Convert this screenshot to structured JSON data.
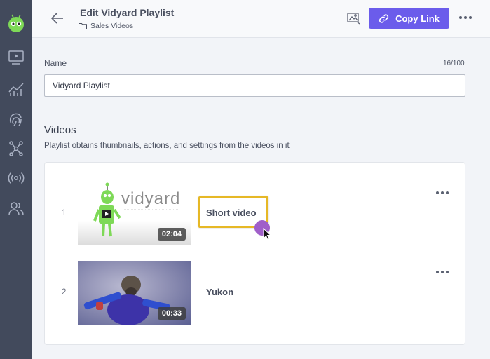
{
  "header": {
    "title": "Edit Vidyard Playlist",
    "breadcrumb": "Sales Videos",
    "copy_link_label": "Copy Link"
  },
  "name_field": {
    "label": "Name",
    "counter": "16/100",
    "value": "Vidyard Playlist"
  },
  "videos": {
    "heading": "Videos",
    "description": "Playlist obtains thumbnails, actions, and settings from the videos in it",
    "items": [
      {
        "index": "1",
        "title": "Short video",
        "duration": "02:04",
        "thumbnail_text": "vidyard"
      },
      {
        "index": "2",
        "title": "Yukon",
        "duration": "00:33"
      }
    ]
  },
  "sidebar": {
    "icons": [
      "logo-robot-icon",
      "video-library-icon",
      "analytics-icon",
      "fingerprint-icon",
      "network-icon",
      "broadcast-icon",
      "users-icon"
    ]
  },
  "colors": {
    "sidebar_bg": "#424a5c",
    "accent": "#6b5ceb",
    "highlight": "#e6b826",
    "cursor_dot": "#a05fc9"
  }
}
